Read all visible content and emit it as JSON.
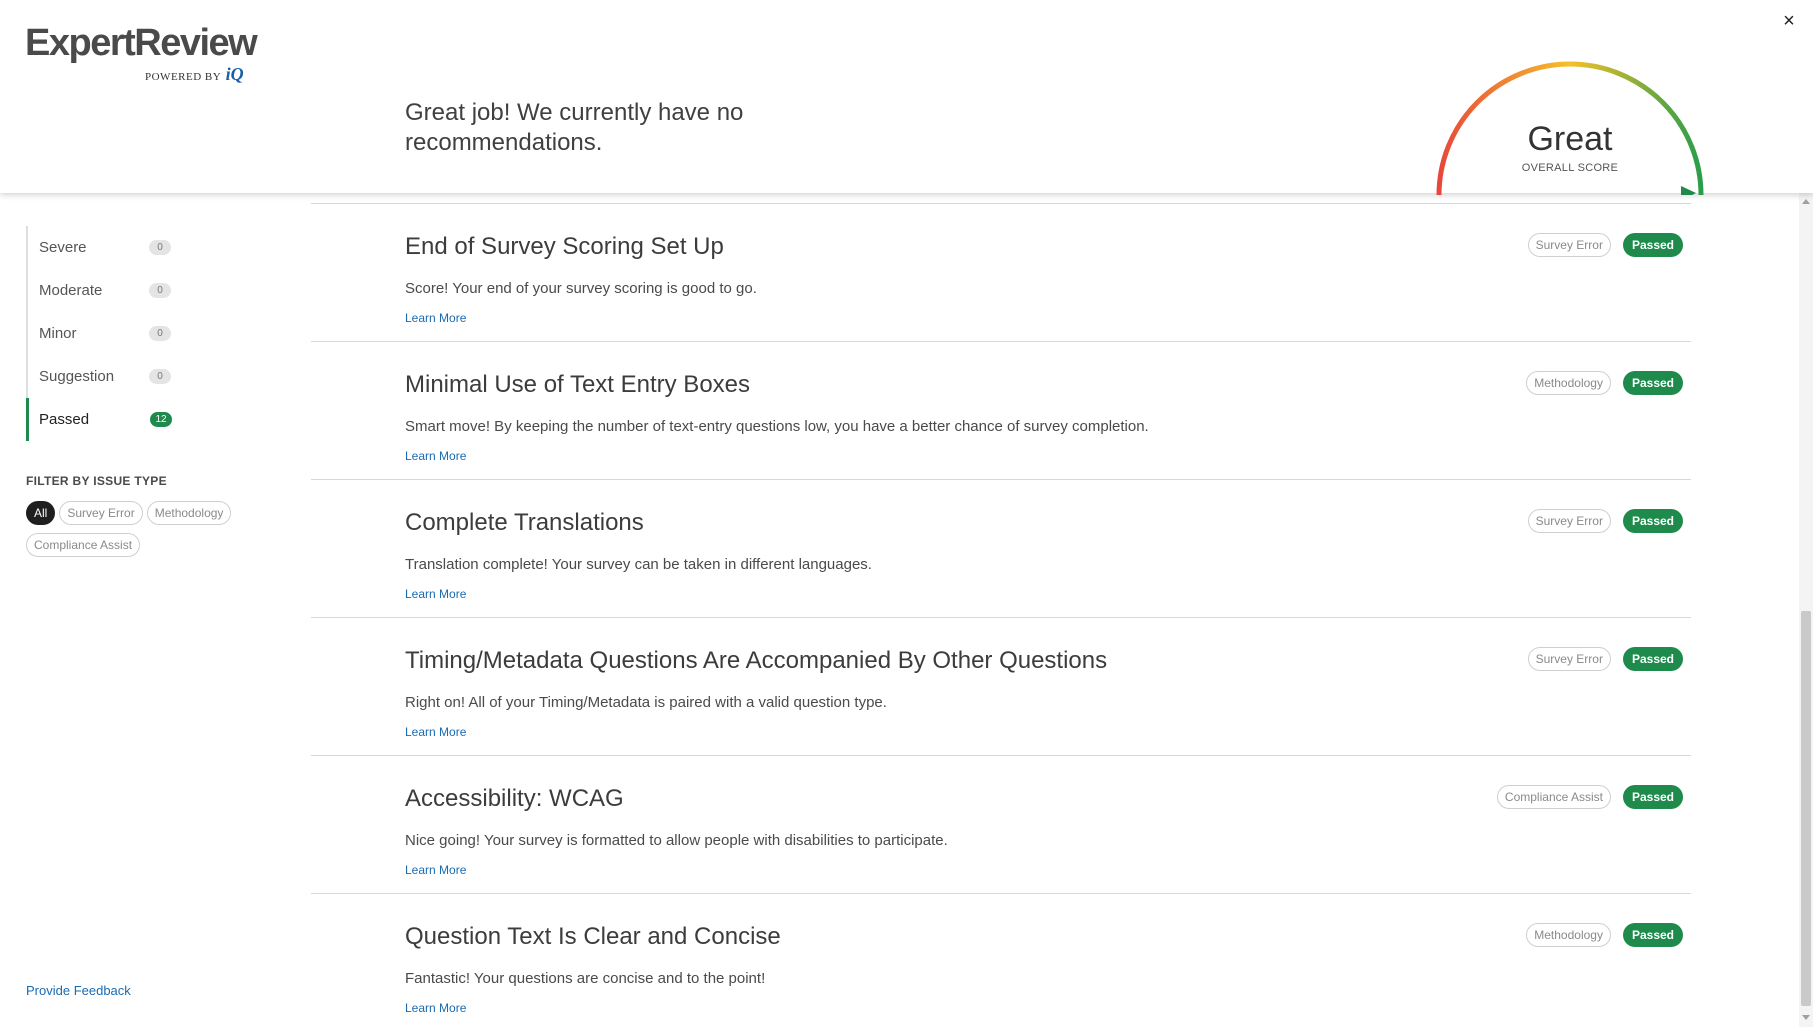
{
  "logo": {
    "name": "ExpertReview",
    "powered_by": "POWERED BY",
    "brand": "iQ"
  },
  "header": {
    "message": "Great job! We currently have no recommendations.",
    "close_label": "×",
    "gauge_word": "Great",
    "gauge_label": "OVERALL SCORE",
    "score": 1.0
  },
  "sidebar": {
    "severity": [
      {
        "label": "Severe",
        "count": "0"
      },
      {
        "label": "Moderate",
        "count": "0"
      },
      {
        "label": "Minor",
        "count": "0"
      },
      {
        "label": "Suggestion",
        "count": "0"
      },
      {
        "label": "Passed",
        "count": "12",
        "active": true
      }
    ],
    "filter_title": "FILTER BY ISSUE TYPE",
    "filters": [
      "All",
      "Survey Error",
      "Methodology",
      "Compliance Assist"
    ],
    "selected_filter": "All",
    "feedback": "Provide Feedback"
  },
  "items": [
    {
      "title": "End of Survey Scoring Set Up",
      "desc": "Score! Your end of your survey scoring is good to go.",
      "link": "Learn More",
      "type": "Survey Error",
      "status": "Passed"
    },
    {
      "title": "Minimal Use of Text Entry Boxes",
      "desc": "Smart move! By keeping the number of text-entry questions low, you have a better chance of survey completion.",
      "link": "Learn More",
      "type": "Methodology",
      "status": "Passed"
    },
    {
      "title": "Complete Translations",
      "desc": "Translation complete! Your survey can be taken in different languages.",
      "link": "Learn More",
      "type": "Survey Error",
      "status": "Passed"
    },
    {
      "title": "Timing/Metadata Questions Are Accompanied By Other Questions",
      "desc": "Right on! All of your Timing/Metadata is paired with a valid question type.",
      "link": "Learn More",
      "type": "Survey Error",
      "status": "Passed"
    },
    {
      "title": "Accessibility: WCAG",
      "desc": "Nice going! Your survey is formatted to allow people with disabilities to participate.",
      "link": "Learn More",
      "type": "Compliance Assist",
      "status": "Passed"
    },
    {
      "title": "Question Text Is Clear and Concise",
      "desc": "Fantastic! Your questions are concise and to the point!",
      "link": "Learn More",
      "type": "Methodology",
      "status": "Passed"
    }
  ],
  "colors": {
    "accent_green": "#1e8a4c",
    "link_blue": "#1b6bb0",
    "gauge_red": "#e8473b",
    "gauge_yellow": "#f5c02a",
    "gauge_green": "#2a9d4a"
  }
}
